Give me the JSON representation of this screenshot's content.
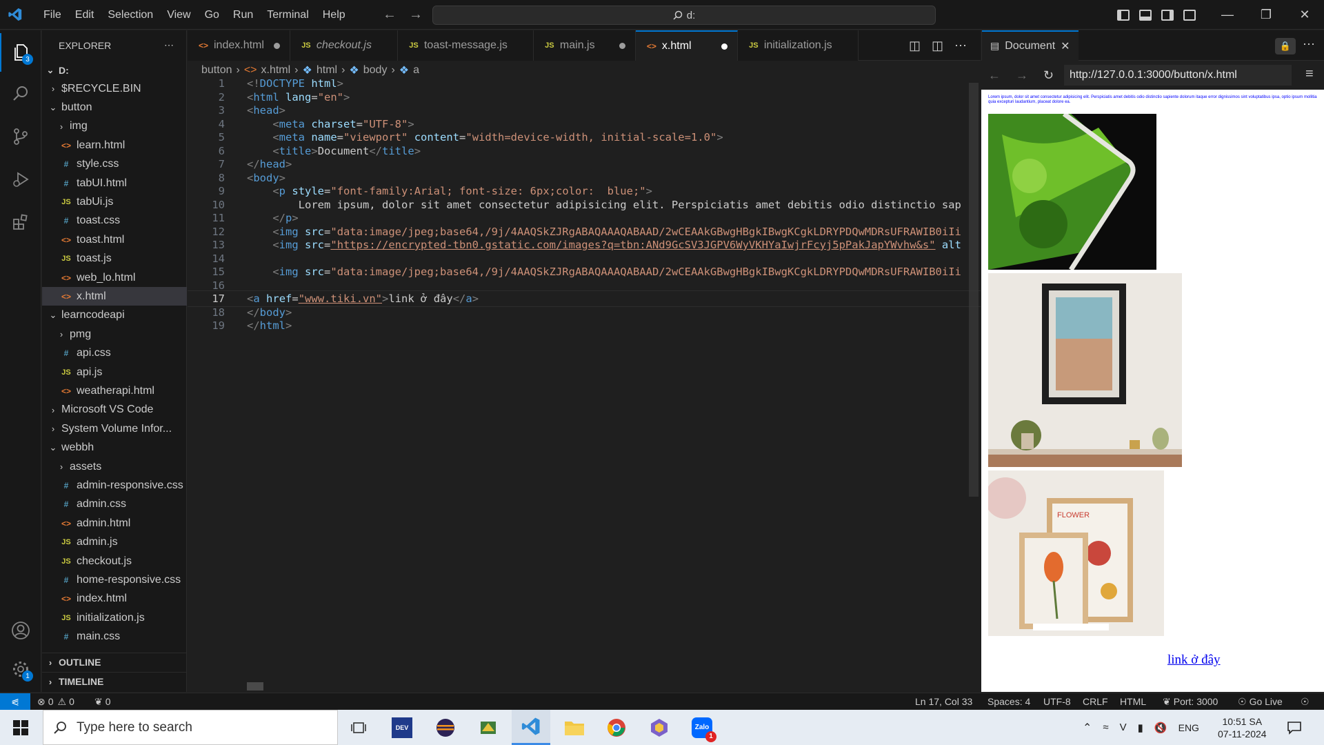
{
  "titlebar": {
    "menu": [
      "File",
      "Edit",
      "Selection",
      "View",
      "Go",
      "Run",
      "Terminal",
      "Help"
    ],
    "command_center": "d:"
  },
  "activity_bar": {
    "explorer_badge": "3",
    "settings_badge": "1"
  },
  "explorer": {
    "title": "EXPLORER",
    "root": "D:",
    "items": [
      {
        "label": "$RECYCLE.BIN",
        "type": "folder",
        "open": false,
        "indent": 1
      },
      {
        "label": "button",
        "type": "folder",
        "open": true,
        "indent": 1
      },
      {
        "label": "img",
        "type": "folder",
        "open": false,
        "indent": 2
      },
      {
        "label": "learn.html",
        "type": "html",
        "indent": 2
      },
      {
        "label": "style.css",
        "type": "css",
        "indent": 2
      },
      {
        "label": "tabUI.html",
        "type": "css",
        "indent": 2
      },
      {
        "label": "tabUi.js",
        "type": "js",
        "indent": 2
      },
      {
        "label": "toast.css",
        "type": "css",
        "indent": 2
      },
      {
        "label": "toast.html",
        "type": "html",
        "indent": 2
      },
      {
        "label": "toast.js",
        "type": "js",
        "indent": 2
      },
      {
        "label": "web_lo.html",
        "type": "html",
        "indent": 2
      },
      {
        "label": "x.html",
        "type": "html",
        "indent": 2,
        "selected": true
      },
      {
        "label": "learncodeapi",
        "type": "folder",
        "open": true,
        "indent": 1
      },
      {
        "label": "pmg",
        "type": "folder",
        "open": false,
        "indent": 2
      },
      {
        "label": "api.css",
        "type": "css",
        "indent": 2
      },
      {
        "label": "api.js",
        "type": "js",
        "indent": 2
      },
      {
        "label": "weatherapi.html",
        "type": "html",
        "indent": 2
      },
      {
        "label": "Microsoft VS Code",
        "type": "folder",
        "open": false,
        "indent": 1
      },
      {
        "label": "System Volume Infor...",
        "type": "folder",
        "open": false,
        "indent": 1
      },
      {
        "label": "webbh",
        "type": "folder",
        "open": true,
        "indent": 1
      },
      {
        "label": "assets",
        "type": "folder",
        "open": false,
        "indent": 2
      },
      {
        "label": "admin-responsive.css",
        "type": "css",
        "indent": 2
      },
      {
        "label": "admin.css",
        "type": "css",
        "indent": 2
      },
      {
        "label": "admin.html",
        "type": "html",
        "indent": 2
      },
      {
        "label": "admin.js",
        "type": "js",
        "indent": 2
      },
      {
        "label": "checkout.js",
        "type": "js",
        "indent": 2
      },
      {
        "label": "home-responsive.css",
        "type": "css",
        "indent": 2
      },
      {
        "label": "index.html",
        "type": "html",
        "indent": 2
      },
      {
        "label": "initialization.js",
        "type": "js",
        "indent": 2
      },
      {
        "label": "main.css",
        "type": "css",
        "indent": 2
      }
    ],
    "outline": "OUTLINE",
    "timeline": "TIMELINE"
  },
  "tabs": [
    {
      "label": "index.html",
      "type": "html",
      "dirty": true,
      "active": false,
      "italic": false
    },
    {
      "label": "checkout.js",
      "type": "js",
      "dirty": false,
      "active": false,
      "italic": true
    },
    {
      "label": "toast-message.js",
      "type": "js",
      "dirty": false,
      "active": false,
      "italic": false
    },
    {
      "label": "main.js",
      "type": "js",
      "dirty": true,
      "active": false,
      "italic": false
    },
    {
      "label": "x.html",
      "type": "html",
      "dirty": true,
      "active": true,
      "italic": false
    },
    {
      "label": "initialization.js",
      "type": "js",
      "dirty": false,
      "active": false,
      "italic": false
    }
  ],
  "breadcrumb": [
    "button",
    "x.html",
    "html",
    "body",
    "a"
  ],
  "code": {
    "current_line": 17,
    "lines": [
      "<!DOCTYPE html>",
      "<html lang=\"en\">",
      "<head>",
      "    <meta charset=\"UTF-8\">",
      "    <meta name=\"viewport\" content=\"width=device-width, initial-scale=1.0\">",
      "    <title>Document</title>",
      "</head>",
      "<body>",
      "    <p style=\"font-family:Arial; font-size: 6px;color:  blue;\">",
      "        Lorem ipsum, dolor sit amet consectetur adipisicing elit. Perspiciatis amet debitis odio distinctio sap",
      "    </p>",
      "    <img src=\"data:image/jpeg;base64,/9j/4AAQSkZJRgABAQAAAQABAAD/2wCEAAkGBwgHBgkIBwgKCgkLDRYPDQwMDRsUFRAWIB0iIi",
      "    <img src=\"https://encrypted-tbn0.gstatic.com/images?q=tbn:ANd9GcSV3JGPV6WyVKHYaIwjrFcyj5pPakJapYWvhw&s\" alt",
      "",
      "    <img src=\"data:image/jpeg;base64,/9j/4AAQSkZJRgABAQAAAQABAAD/2wCEAAkGBwgHBgkIBwgKCgkLDRYPDQwMDRsUFRAWIB0iIi",
      "",
      "<a href=\"www.tiki.vn\">link ở đây</a>",
      "</body>",
      "</html>"
    ]
  },
  "preview": {
    "tab_title": "Document",
    "url": "http://127.0.0.1:3000/button/x.html",
    "paragraph": "Lorem ipsum, dolor sit amet consectetur adipisicing elit. Perspiciatis amet debitis odio distinctio sapiente dolorum itaque error dignissimos sint voluptatibus ipsa, optio ipsum mollitia quia excepturi laudantium, placeat dolore ea.",
    "link_text": "link ở đây"
  },
  "statusbar": {
    "errors": "0",
    "warnings": "0",
    "ports": "0",
    "position": "Ln 17, Col 33",
    "spaces": "Spaces: 4",
    "encoding": "UTF-8",
    "eol": "CRLF",
    "language": "HTML",
    "port": "Port: 3000",
    "golive": "Go Live"
  },
  "taskbar": {
    "search_placeholder": "Type here to search",
    "time": "10:51 SA",
    "date": "07-11-2024",
    "lang": "ENG",
    "zalo_badge": "1"
  },
  "colors": {
    "accent": "#0078d4",
    "editor_bg": "#1f1f1f",
    "chrome_bg": "#181818"
  }
}
